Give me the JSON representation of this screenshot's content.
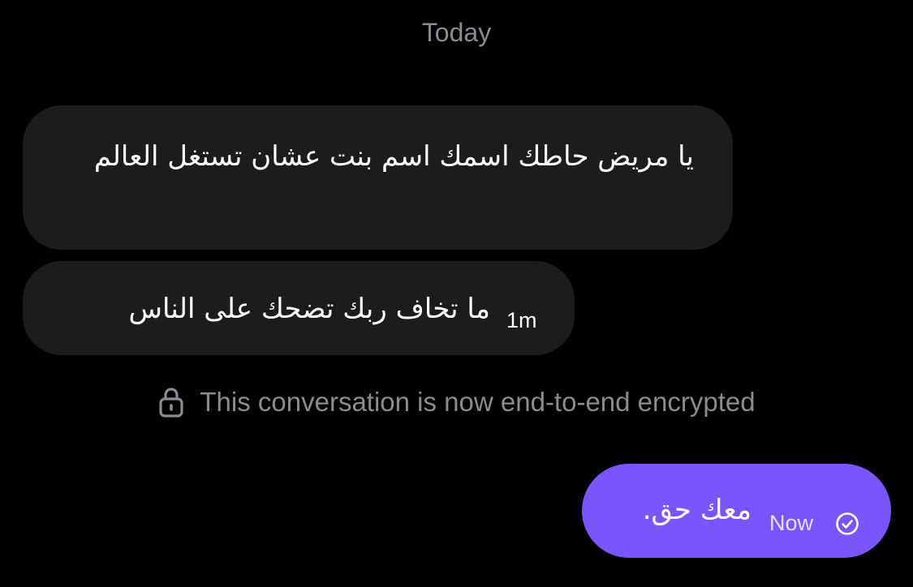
{
  "conversation": {
    "date_divider": "Today",
    "encryption_notice": "This conversation is now end-to-end encrypted",
    "messages": [
      {
        "sender": "other",
        "text": "يا مريض حاطك اسمك اسم بنت عشان تستغل العالم",
        "time": ""
      },
      {
        "sender": "other",
        "text": "ما تخاف ربك تضحك على الناس",
        "time": "1m"
      },
      {
        "sender": "me",
        "text": "معك حق.",
        "time": "Now",
        "status_icon": "check-circle-icon"
      }
    ]
  },
  "colors": {
    "background": "#000000",
    "incoming_bubble": "#1c1c1e",
    "outgoing_bubble": "#7b55fc",
    "muted_text": "#8b8b90"
  }
}
